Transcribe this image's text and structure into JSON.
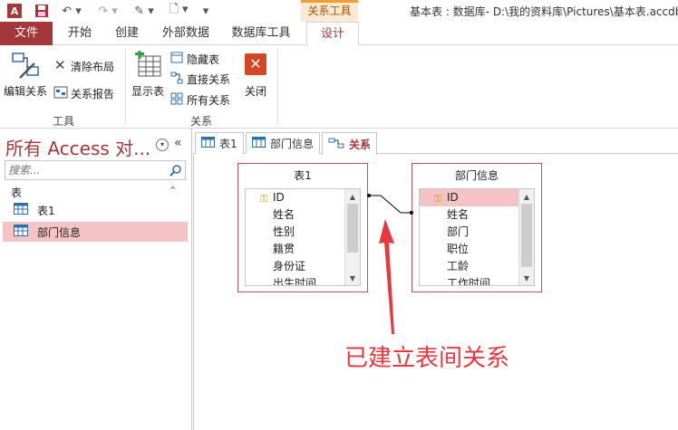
{
  "window": {
    "title": "基本表 : 数据库- D:\\我的资料库\\Pictures\\基本表.accdb",
    "context_tab_header": "关系工具"
  },
  "ribbon_tabs": [
    "文件",
    "开始",
    "创建",
    "外部数据",
    "数据库工具",
    "设计"
  ],
  "ribbon": {
    "edit_relationships": "编辑关系",
    "clear_layout": "清除布局",
    "relationship_report": "关系报告",
    "tools_group": "工具",
    "show_table": "显示表",
    "hide_table": "隐藏表",
    "direct_relationships": "直接关系",
    "all_relationships": "所有关系",
    "close": "关闭",
    "relationships_group": "关系"
  },
  "nav": {
    "title": "所有 Access 对...",
    "search_placeholder": "搜索...",
    "section": "表",
    "items": [
      "表1",
      "部门信息"
    ]
  },
  "doc_tabs": [
    "表1",
    "部门信息",
    "关系"
  ],
  "tables": {
    "t1": {
      "title": "表1",
      "fields": [
        "ID",
        "姓名",
        "性别",
        "籍贯",
        "身份证",
        "出生时间"
      ]
    },
    "t2": {
      "title": "部门信息",
      "fields": [
        "ID",
        "姓名",
        "部门",
        "职位",
        "工龄",
        "工作时间"
      ]
    }
  },
  "annotation": "已建立表间关系",
  "colors": {
    "accent": "#a4373a",
    "selection": "#f5c2c5",
    "annotation": "#e8383d"
  }
}
